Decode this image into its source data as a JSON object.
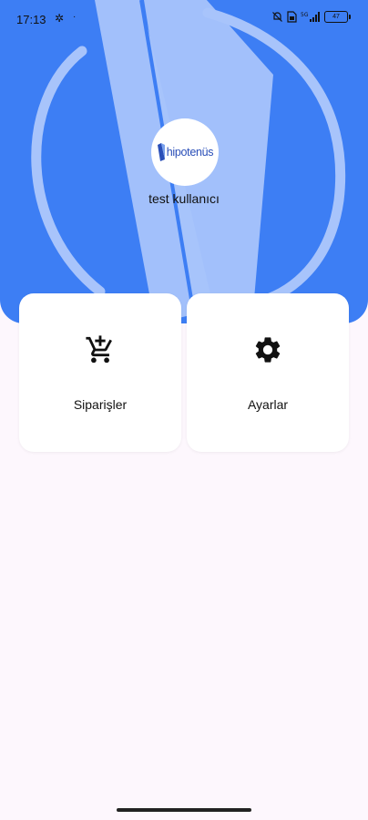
{
  "status_bar": {
    "time": "17:13",
    "left_icon": "settings-gear-status-icon",
    "dot": "·",
    "battery": "47"
  },
  "header": {
    "logo_text": "hipotenüs",
    "username": "test kullanıcı",
    "background_color": "#3d7ef4"
  },
  "menu": {
    "orders_label": "Siparişler",
    "orders_icon": "add-to-cart-icon",
    "settings_label": "Ayarlar",
    "settings_icon": "gear-icon"
  }
}
